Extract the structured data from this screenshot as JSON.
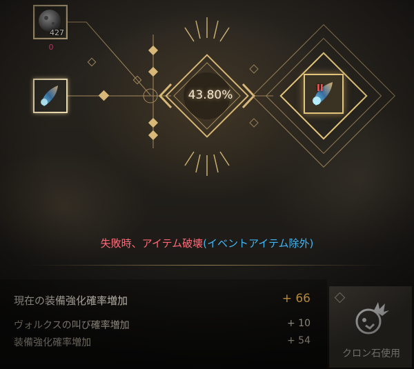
{
  "materials": {
    "enhance_material": {
      "icon": "black-stone-icon",
      "quantity": "427",
      "owned_count": "0"
    },
    "target_item": {
      "icon": "gem-item-icon"
    }
  },
  "enhance": {
    "success_rate": "43.80%"
  },
  "result": {
    "icon": "gem-item-icon",
    "level_badge": "II"
  },
  "warning": {
    "part1": "失敗時、アイテム破壊",
    "part2": "(イベントアイテム除外)",
    "colors": {
      "part1": "#ff6a78",
      "part2": "#43b6f3"
    }
  },
  "stats": {
    "current_bonus": {
      "label": "現在の装備強化確率増加",
      "value": "+ 66"
    },
    "valks_cry": {
      "label": "ヴォルクスの叫び確率増加",
      "value": "+ 10"
    },
    "enhance_bonus": {
      "label": "装備強化確率増加",
      "value": "+ 54"
    }
  },
  "cron_stone": {
    "label": "クロン石使用",
    "icon": "cron-stone-icon"
  },
  "theme": {
    "accent": "#d8b878",
    "highlight": "#e8b04a"
  }
}
